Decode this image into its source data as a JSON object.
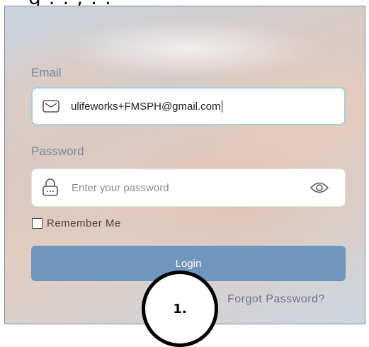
{
  "header": {
    "cropped_text": "g . . , . ."
  },
  "form": {
    "email_label": "Email",
    "email_value": "ulifeworks+FMSPH@gmail.com",
    "password_label": "Password",
    "password_placeholder": "Enter your password",
    "remember_label": "Remember Me",
    "remember_checked": false,
    "login_label": "Login",
    "forgot_label": "Forgot Password?"
  },
  "annotation": {
    "step": "1."
  },
  "icons": {
    "email": "mail-icon",
    "password": "lock-icon",
    "toggle": "eye-icon"
  },
  "colors": {
    "login_button": "#6f97bd",
    "email_focus_border": "#9fd2dd",
    "label_text": "#7a8697"
  }
}
